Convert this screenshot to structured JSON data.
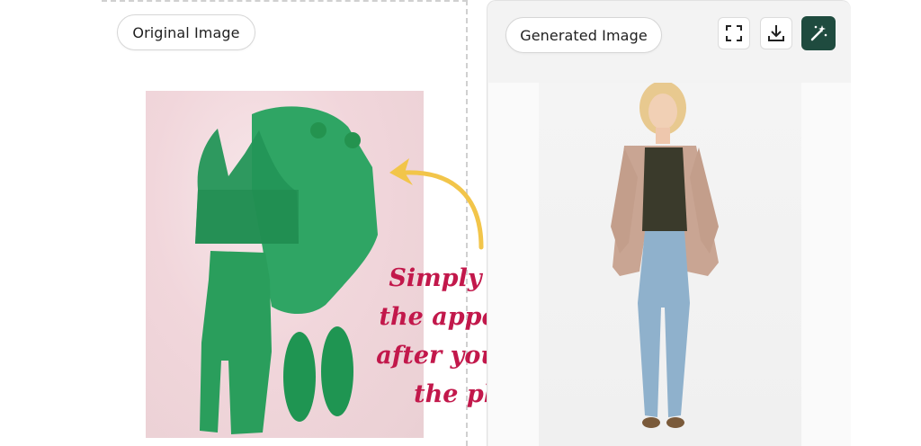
{
  "panels": {
    "original_label": "Original Image",
    "generated_label": "Generated Image"
  },
  "toolbar": {
    "fullscreen_icon": "fullscreen-icon",
    "download_icon": "download-icon",
    "magic_icon": "magic-wand-icon",
    "magic_color": "#1f4b3f"
  },
  "caption": {
    "lines": [
      "Simply select",
      "the appearales",
      "after you uload",
      "the photo"
    ],
    "color": "#c2184b"
  },
  "colors": {
    "garment_green": "#2fa564",
    "arrow_yellow": "#f2c54a"
  }
}
